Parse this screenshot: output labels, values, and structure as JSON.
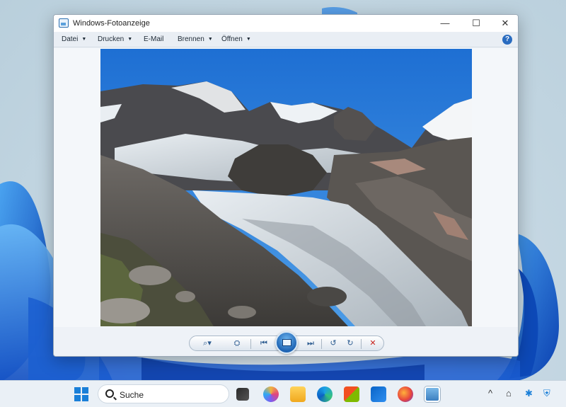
{
  "window": {
    "title": "Windows-Fotoanzeige",
    "minimize_glyph": "—",
    "maximize_glyph": "☐",
    "close_glyph": "✕"
  },
  "menu": {
    "items": [
      {
        "label": "Datei",
        "has_dropdown": true
      },
      {
        "label": "Drucken",
        "has_dropdown": true
      },
      {
        "label": "E-Mail",
        "has_dropdown": false
      },
      {
        "label": "Brennen",
        "has_dropdown": true
      },
      {
        "label": "Öffnen",
        "has_dropdown": true
      }
    ],
    "caret": "▼",
    "help_label": "?"
  },
  "photo": {
    "subject": "mountain glacier landscape"
  },
  "toolbar": {
    "zoom_glyph": "⌕▾",
    "fit_glyph": "⛭",
    "prev_glyph": "⏮",
    "next_glyph": "⏭",
    "rotate_ccw_glyph": "↺",
    "rotate_cw_glyph": "↻",
    "delete_glyph": "✕"
  },
  "taskbar": {
    "search_label": "Suche",
    "apps": [
      "task-view",
      "copilot",
      "file-explorer",
      "edge",
      "store",
      "outlook",
      "firefox",
      "photo-viewer"
    ],
    "tray_chevron": "^",
    "tray_glyphs": [
      "⌂",
      "✱",
      "⛨"
    ]
  },
  "colors": {
    "accent": "#1a7fd8",
    "sky": "#2a7fd9",
    "delete_red": "#c8211c"
  }
}
